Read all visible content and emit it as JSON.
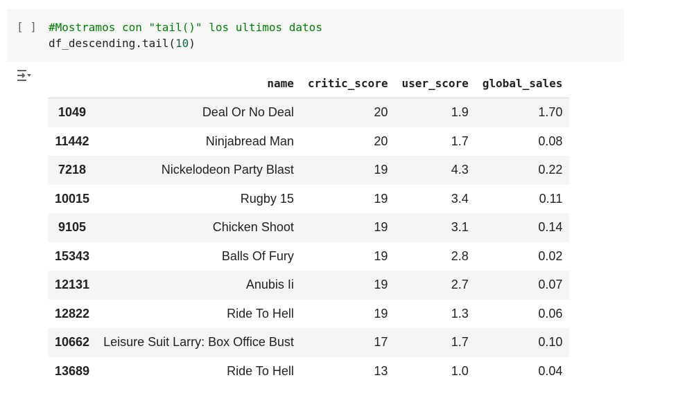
{
  "cell": {
    "run_button": "[ ]",
    "code_comment": "#Mostramos con \"tail()\" los ultimos datos",
    "code_call_prefix": "df_descending.tail(",
    "code_call_arg": "10",
    "code_call_suffix": ")"
  },
  "output": {
    "icon": "output-toggle-icon",
    "table": {
      "index_header": "",
      "columns": [
        "name",
        "critic_score",
        "user_score",
        "global_sales"
      ],
      "rows": [
        {
          "index": "1049",
          "name": "Deal Or No Deal",
          "critic_score": "20",
          "user_score": "1.9",
          "global_sales": "1.70"
        },
        {
          "index": "11442",
          "name": "Ninjabread Man",
          "critic_score": "20",
          "user_score": "1.7",
          "global_sales": "0.08"
        },
        {
          "index": "7218",
          "name": "Nickelodeon Party Blast",
          "critic_score": "19",
          "user_score": "4.3",
          "global_sales": "0.22"
        },
        {
          "index": "10015",
          "name": "Rugby 15",
          "critic_score": "19",
          "user_score": "3.4",
          "global_sales": "0.11"
        },
        {
          "index": "9105",
          "name": "Chicken Shoot",
          "critic_score": "19",
          "user_score": "3.1",
          "global_sales": "0.14"
        },
        {
          "index": "15343",
          "name": "Balls Of Fury",
          "critic_score": "19",
          "user_score": "2.8",
          "global_sales": "0.02"
        },
        {
          "index": "12131",
          "name": "Anubis Ii",
          "critic_score": "19",
          "user_score": "2.7",
          "global_sales": "0.07"
        },
        {
          "index": "12822",
          "name": "Ride To Hell",
          "critic_score": "19",
          "user_score": "1.3",
          "global_sales": "0.06"
        },
        {
          "index": "10662",
          "name": "Leisure Suit Larry: Box Office Bust",
          "critic_score": "17",
          "user_score": "1.7",
          "global_sales": "0.10"
        },
        {
          "index": "13689",
          "name": "Ride To Hell",
          "critic_score": "13",
          "user_score": "1.0",
          "global_sales": "0.04"
        }
      ]
    }
  },
  "colors": {
    "cell_background": "#f7f7f7",
    "comment": "#008000",
    "number": "#116644",
    "row_stripe": "#f5f5f5"
  }
}
